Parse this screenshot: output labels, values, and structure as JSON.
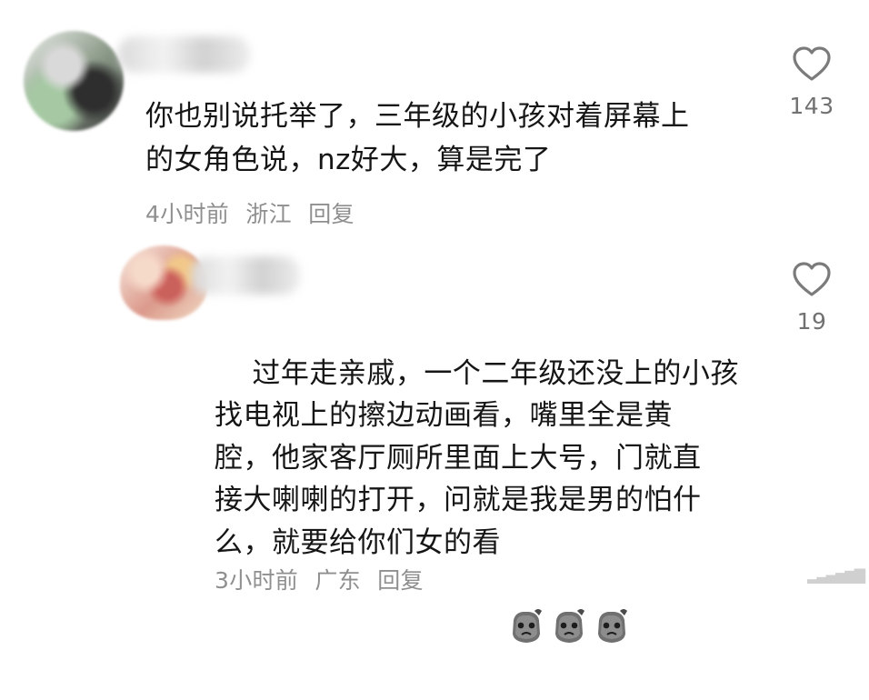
{
  "comments": [
    {
      "text": "你也别说托举了，三年级的小孩对着屏幕上\n的女角色说，nz好大，算是完了",
      "time": "4小时前",
      "location": "浙江",
      "reply_label": "回复",
      "likes": "143",
      "icon": "heart-outline-icon"
    },
    {
      "text": "过年走亲戚，一个二年级还没上的小孩\n找电视上的擦边动画看，嘴里全是黄\n腔，他家客厅厕所里面上大号，门就直\n接大喇喇的打开，问就是我是男的怕什\n么，就要给你们女的看",
      "time": "3小时前",
      "location": "广东",
      "reply_label": "回复",
      "likes": "19",
      "icon": "heart-outline-icon",
      "emojis": [
        "sad-face-emoji",
        "sad-face-emoji",
        "sad-face-emoji"
      ]
    }
  ]
}
